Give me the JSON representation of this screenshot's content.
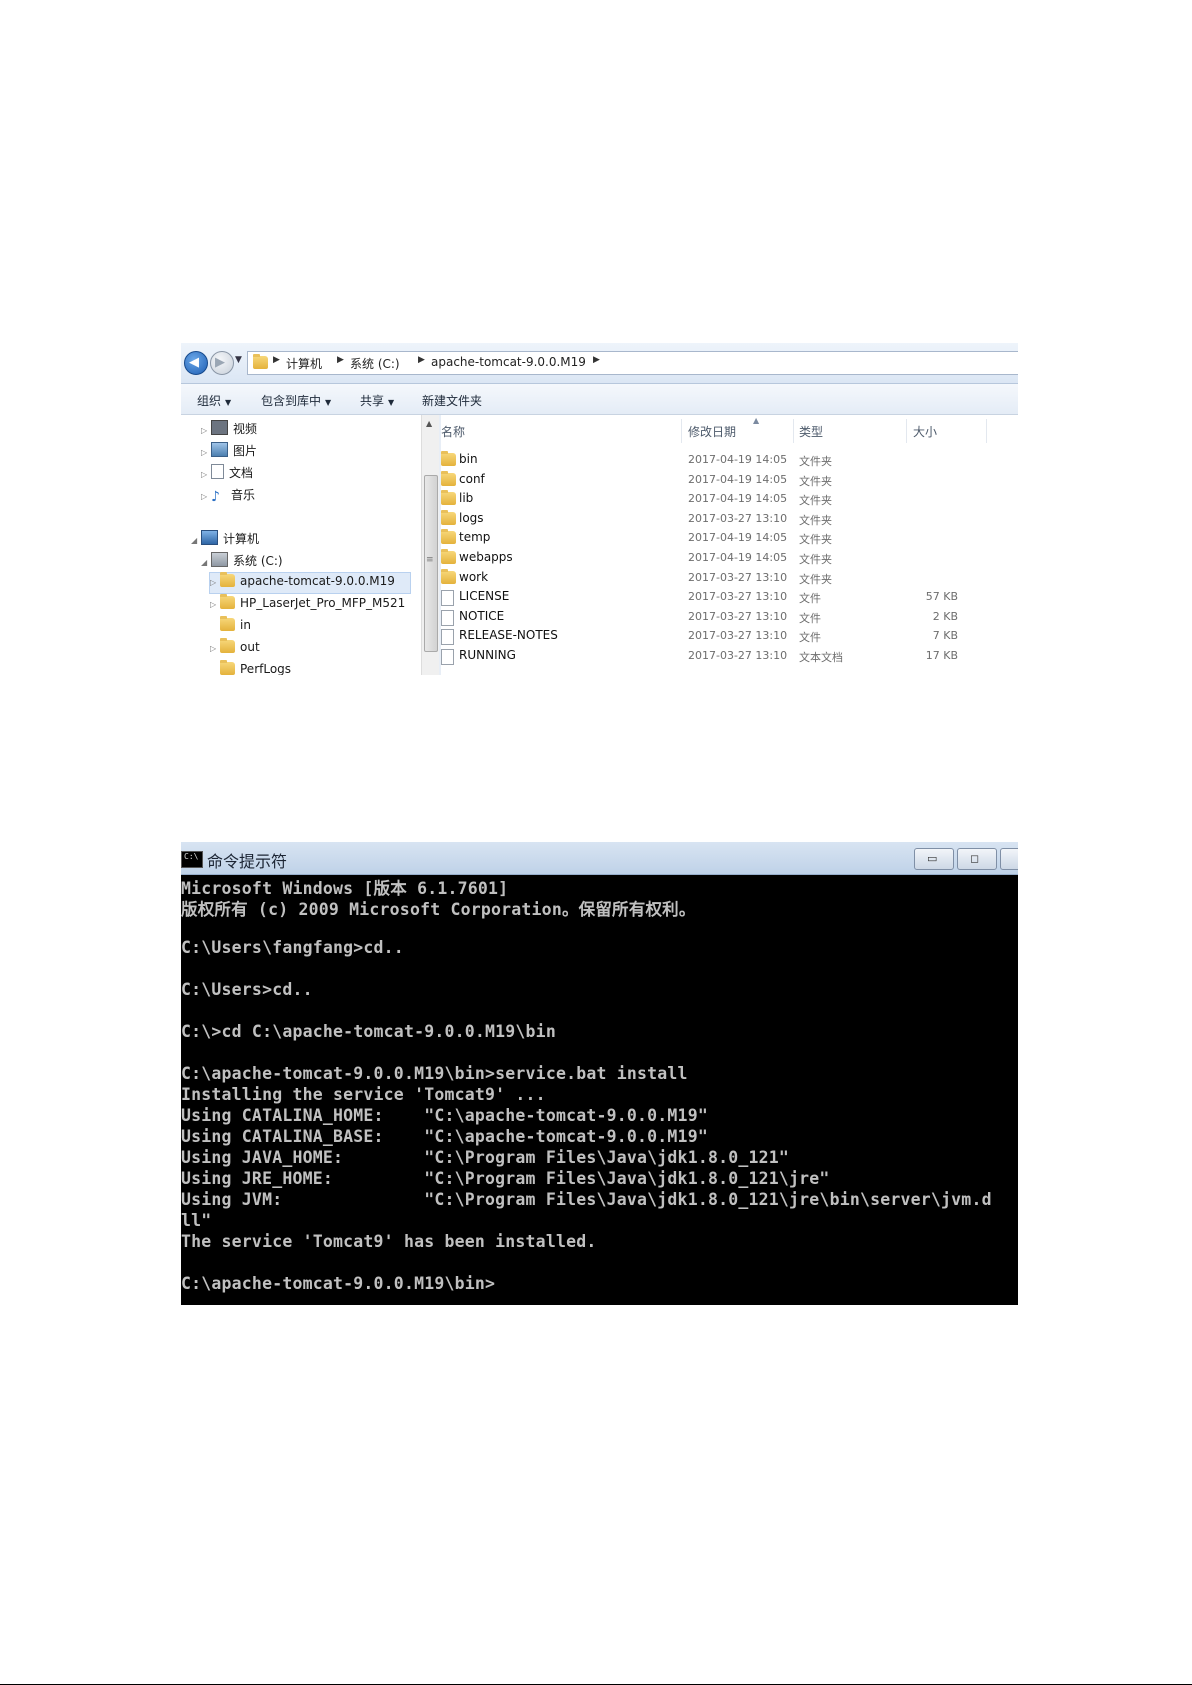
{
  "explorer": {
    "breadcrumb": [
      "计算机",
      "系统 (C:)",
      "apache-tomcat-9.0.0.M19"
    ],
    "toolbar": [
      {
        "label": "组织",
        "dropdown": true
      },
      {
        "label": "包含到库中",
        "dropdown": true
      },
      {
        "label": "共享",
        "dropdown": true
      },
      {
        "label": "新建文件夹",
        "dropdown": false
      }
    ],
    "nav_tree": [
      {
        "label": "视频",
        "icon": "video-icon"
      },
      {
        "label": "图片",
        "icon": "pictures-icon"
      },
      {
        "label": "文档",
        "icon": "documents-icon"
      },
      {
        "label": "音乐",
        "icon": "music-icon"
      },
      {
        "label": "计算机",
        "icon": "computer-icon"
      },
      {
        "label": "系统 (C:)",
        "icon": "drive-icon"
      },
      {
        "label": "apache-tomcat-9.0.0.M19",
        "icon": "folder-icon",
        "selected": true
      },
      {
        "label": "HP_LaserJet_Pro_MFP_M521",
        "icon": "folder-icon"
      },
      {
        "label": "in",
        "icon": "folder-icon"
      },
      {
        "label": "out",
        "icon": "folder-icon"
      },
      {
        "label": "PerfLogs",
        "icon": "folder-icon"
      }
    ],
    "columns": {
      "name": "名称",
      "modified": "修改日期",
      "type": "类型",
      "size": "大小"
    },
    "files": [
      {
        "name": "bin",
        "modified": "2017-04-19 14:05",
        "type": "文件夹",
        "size": "",
        "icon": "folder-icon"
      },
      {
        "name": "conf",
        "modified": "2017-04-19 14:05",
        "type": "文件夹",
        "size": "",
        "icon": "folder-icon"
      },
      {
        "name": "lib",
        "modified": "2017-04-19 14:05",
        "type": "文件夹",
        "size": "",
        "icon": "folder-icon"
      },
      {
        "name": "logs",
        "modified": "2017-03-27 13:10",
        "type": "文件夹",
        "size": "",
        "icon": "folder-icon"
      },
      {
        "name": "temp",
        "modified": "2017-04-19 14:05",
        "type": "文件夹",
        "size": "",
        "icon": "folder-icon"
      },
      {
        "name": "webapps",
        "modified": "2017-04-19 14:05",
        "type": "文件夹",
        "size": "",
        "icon": "folder-icon"
      },
      {
        "name": "work",
        "modified": "2017-03-27 13:10",
        "type": "文件夹",
        "size": "",
        "icon": "folder-icon"
      },
      {
        "name": "LICENSE",
        "modified": "2017-03-27 13:10",
        "type": "文件",
        "size": "57 KB",
        "icon": "file-icon"
      },
      {
        "name": "NOTICE",
        "modified": "2017-03-27 13:10",
        "type": "文件",
        "size": "2 KB",
        "icon": "file-icon"
      },
      {
        "name": "RELEASE-NOTES",
        "modified": "2017-03-27 13:10",
        "type": "文件",
        "size": "7 KB",
        "icon": "file-icon"
      },
      {
        "name": "RUNNING",
        "modified": "2017-03-27 13:10",
        "type": "文本文档",
        "size": "17 KB",
        "icon": "file-icon"
      }
    ]
  },
  "cmd": {
    "title": "命令提示符",
    "window_buttons": [
      "minimize-icon",
      "maximize-icon"
    ],
    "lines": [
      "Microsoft Windows [版本 6.1.7601]",
      "版权所有 (c) 2009 Microsoft Corporation。保留所有权利。",
      "",
      "C:\\Users\\fangfang>cd..",
      "",
      "C:\\Users>cd..",
      "",
      "C:\\>cd C:\\apache-tomcat-9.0.0.M19\\bin",
      "",
      "C:\\apache-tomcat-9.0.0.M19\\bin>service.bat install",
      "Installing the service 'Tomcat9' ...",
      "Using CATALINA_HOME:    \"C:\\apache-tomcat-9.0.0.M19\"",
      "Using CATALINA_BASE:    \"C:\\apache-tomcat-9.0.0.M19\"",
      "Using JAVA_HOME:        \"C:\\Program Files\\Java\\jdk1.8.0_121\"",
      "Using JRE_HOME:         \"C:\\Program Files\\Java\\jdk1.8.0_121\\jre\"",
      "Using JVM:              \"C:\\Program Files\\Java\\jdk1.8.0_121\\jre\\bin\\server\\jvm.d",
      "ll\"",
      "The service 'Tomcat9' has been installed.",
      "",
      "C:\\apache-tomcat-9.0.0.M19\\bin>"
    ]
  }
}
